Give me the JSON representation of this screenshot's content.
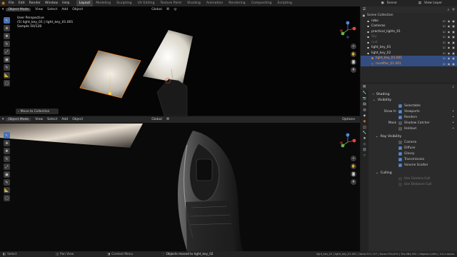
{
  "topbar": {
    "menus": [
      "File",
      "Edit",
      "Render",
      "Window",
      "Help"
    ],
    "workspaces": [
      "Layout",
      "Modeling",
      "Sculpting",
      "UV Editing",
      "Texture Paint",
      "Shading",
      "Animation",
      "Rendering",
      "Compositing",
      "Scripting"
    ],
    "active_workspace": "Layout",
    "scene_label": "Scene",
    "view_layer_label": "View Layer"
  },
  "viewport_top": {
    "mode": "Object Mode",
    "menus": [
      "View",
      "Select",
      "Add",
      "Object"
    ],
    "transform": "Global",
    "overlay_lines": [
      "User Perspective",
      "(5) light_key_01 | light_key_01.001",
      "Sample 50/128"
    ],
    "last_op": "Move to Collection"
  },
  "viewport_bottom": {
    "mode": "Object Mode",
    "menus": [
      "View",
      "Select",
      "Add",
      "Object"
    ],
    "transform": "Global",
    "options": "Options"
  },
  "outliner": {
    "title": "Scene Collection",
    "items": [
      {
        "label": "robo",
        "color": "#d8d8d8",
        "indent": 1,
        "icon": "collection-icon"
      },
      {
        "label": "Cameras",
        "color": "#d8d8d8",
        "indent": 1,
        "icon": "collection-icon"
      },
      {
        "label": "practical_lights_01",
        "color": "#d8d8d8",
        "indent": 1,
        "icon": "collection-icon"
      },
      {
        "label": "Sky",
        "color": "#6a6a6a",
        "indent": 1,
        "icon": "collection-icon"
      },
      {
        "label": "rust",
        "color": "#6a6a6a",
        "indent": 1,
        "icon": "collection-icon"
      },
      {
        "label": "light_key_01",
        "color": "#d8d8d8",
        "indent": 1,
        "icon": "collection-icon"
      },
      {
        "label": "light_key_02",
        "color": "#d8d8d8",
        "indent": 1,
        "icon": "collection-icon"
      },
      {
        "label": "light_key_01.001",
        "color": "#ff9d2e",
        "indent": 2,
        "icon": "light-icon",
        "selected": true
      },
      {
        "label": "modifier_01.001",
        "color": "#ff9d2e",
        "indent": 2,
        "icon": "object-icon",
        "selected": true
      }
    ]
  },
  "properties": {
    "section_shading": "Shading",
    "section_visibility": "Visibility",
    "selectable": "Selectable",
    "show_in_label": "Show In",
    "viewports": "Viewports",
    "renders": "Renders",
    "mask_label": "Mask",
    "shadow_catcher": "Shadow Catcher",
    "holdout": "Holdout",
    "section_ray": "Ray Visibility",
    "ray_items": [
      {
        "label": "Camera",
        "checked": false
      },
      {
        "label": "Diffuse",
        "checked": true
      },
      {
        "label": "Glossy",
        "checked": true
      },
      {
        "label": "Transmission",
        "checked": true
      },
      {
        "label": "Volume Scatter",
        "checked": true
      }
    ],
    "section_culling": "Culling",
    "cull_items": [
      "Use Camera Cull",
      "Use Distance Cull"
    ]
  },
  "statusbar": {
    "select": "Select",
    "pan": "Pan View",
    "context": "Context Menu",
    "message": "Objects moved to light_key_02",
    "stats": "light_key_01 | light_key_01.001 | Verts:571,727 | Faces:750,670 | Tris:984,353 | Objects:1/482 | 3.5.0 Alpha"
  },
  "colors": {
    "accent": "#4772b3",
    "selected_orange": "#ff9d2e",
    "header": "#2b2b2b"
  }
}
